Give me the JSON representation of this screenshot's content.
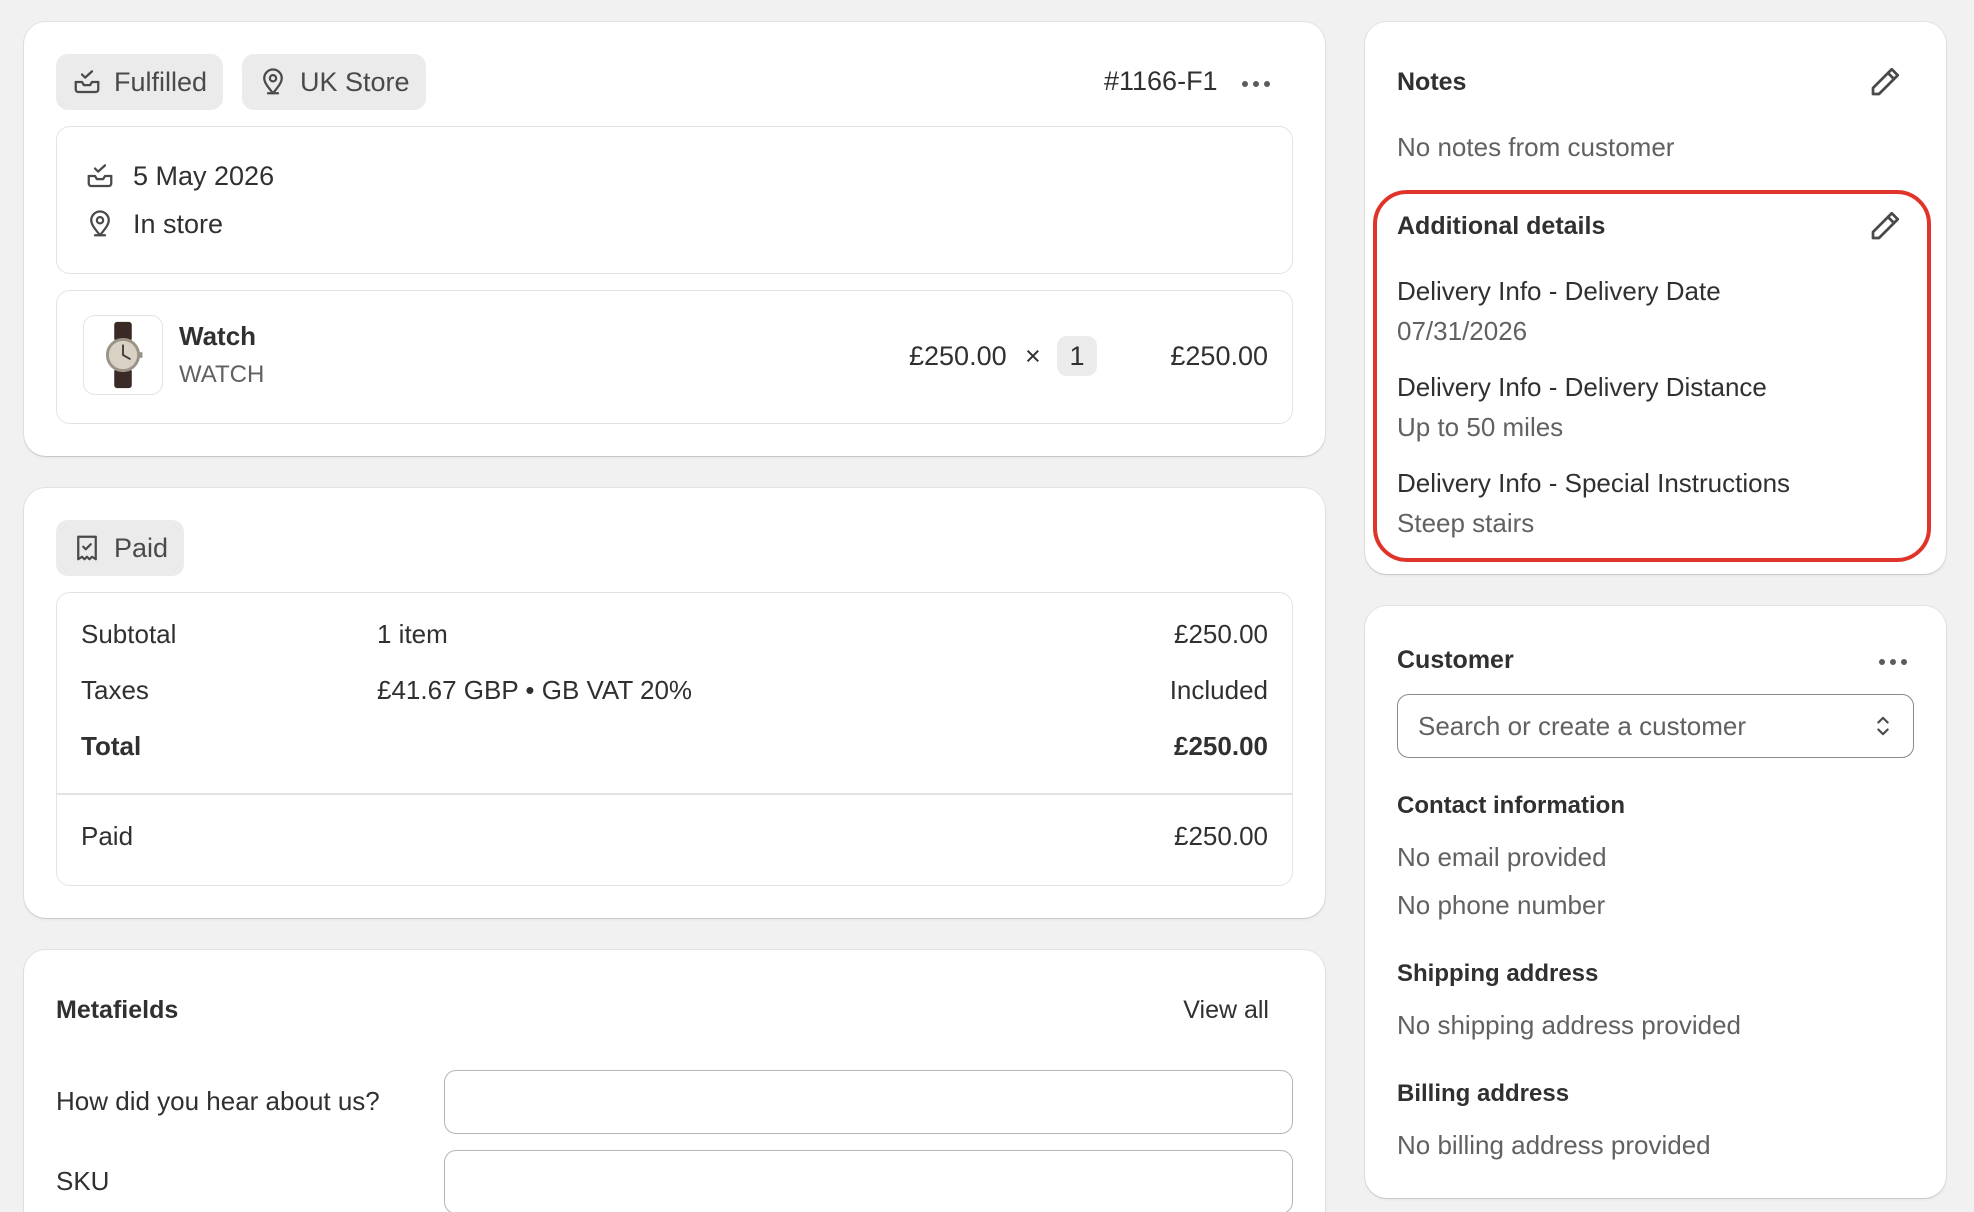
{
  "fulfillment": {
    "status_pill": "Fulfilled",
    "location_pill": "UK Store",
    "order_id": "#1166-F1",
    "date": "5 May 2026",
    "method": "In store",
    "item": {
      "name": "Watch",
      "sku": "WATCH",
      "unit_price": "£250.00",
      "times": "×",
      "quantity": "1",
      "line_total": "£250.00"
    }
  },
  "payment": {
    "status_pill": "Paid",
    "rows": [
      {
        "label": "Subtotal",
        "detail": "1 item",
        "amount": "£250.00"
      },
      {
        "label": "Taxes",
        "detail": "£41.67 GBP • GB VAT 20%",
        "amount": "Included"
      },
      {
        "label": "Total",
        "detail": "",
        "amount": "£250.00"
      }
    ],
    "paid_label": "Paid",
    "paid_amount": "£250.00"
  },
  "metafields": {
    "title": "Metafields",
    "view_all": "View all",
    "fields": [
      {
        "label": "How did you hear about us?",
        "value": ""
      },
      {
        "label": "SKU",
        "value": ""
      }
    ]
  },
  "notes": {
    "title": "Notes",
    "text": "No notes from customer"
  },
  "additional_details": {
    "title": "Additional details",
    "items": [
      {
        "label": "Delivery Info - Delivery Date",
        "value": "07/31/2026"
      },
      {
        "label": "Delivery Info - Delivery Distance",
        "value": "Up to 50 miles"
      },
      {
        "label": "Delivery Info - Special Instructions",
        "value": "Steep stairs"
      }
    ]
  },
  "customer": {
    "title": "Customer",
    "search_placeholder": "Search or create a customer",
    "contact_heading": "Contact information",
    "email": "No email provided",
    "phone": "No phone number",
    "shipping_heading": "Shipping address",
    "shipping": "No shipping address provided",
    "billing_heading": "Billing address",
    "billing": "No billing address provided"
  },
  "colors": {
    "background": "#f1f1f1",
    "card": "#ffffff",
    "pill": "#ebebeb",
    "text": "#303030",
    "subdued": "#616161",
    "highlight": "#e0342a"
  }
}
